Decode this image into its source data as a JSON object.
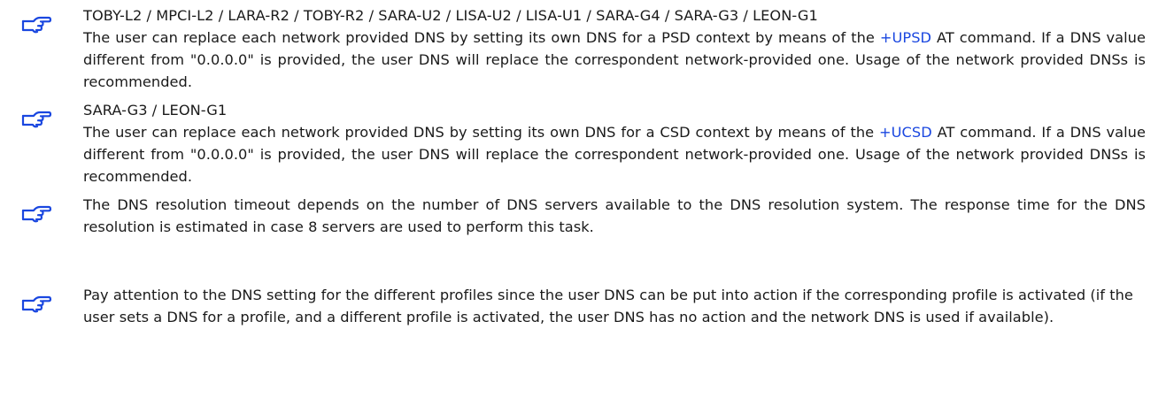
{
  "colors": {
    "text": "#1a1a1a",
    "link": "#1a47e0",
    "icon": "#1a47e0"
  },
  "icon_name": "pointing-hand-icon",
  "notes": [
    {
      "applies_to": "TOBY-L2 / MPCI-L2 / LARA-R2 / TOBY-R2 / SARA-U2 / LISA-U2 / LISA-U1 / SARA-G4 / SARA-G3 / LEON-G1",
      "text_before_link": "The user can replace each network provided DNS by setting its own DNS for a PSD context by means of the ",
      "link": "+UPSD",
      "text_after_link": " AT command. If a DNS value different from \"0.0.0.0\" is provided, the user DNS will replace the correspondent network-provided one. Usage of the network provided DNSs is recommended."
    },
    {
      "applies_to": "SARA-G3 / LEON-G1",
      "text_before_link": "The user can replace each network provided DNS by setting its own DNS for a CSD context by means of the ",
      "link": "+UCSD",
      "text_after_link": " AT command. If a DNS value different from \"0.0.0.0\" is provided, the user DNS will replace the correspondent network-provided one. Usage of the network provided DNSs is recommended."
    },
    {
      "text": "The DNS resolution timeout depends on the number of DNS servers available to the DNS resolution system. The response time for the DNS resolution is estimated in case 8 servers are used to perform this task."
    },
    {
      "text": "Pay attention to the DNS setting for the different profiles since the user DNS can be put into action if the corresponding profile is activated (if the user sets a DNS for a profile, and a different profile is activated, the user DNS has no action and the network DNS is used if available)."
    }
  ]
}
